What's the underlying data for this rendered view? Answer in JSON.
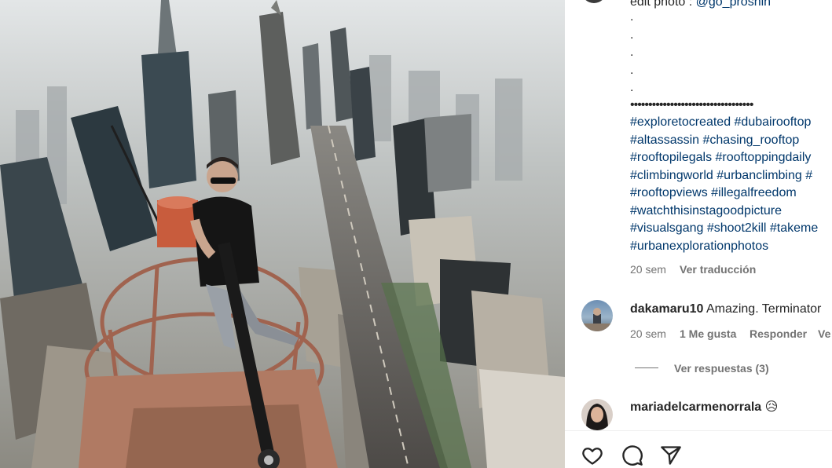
{
  "caption": {
    "edit_prefix": "edit photo : ",
    "edit_handle": "@go_proshin",
    "dot_lines": [
      ".",
      ".",
      ".",
      ".",
      "."
    ],
    "separator": "••••••••••••••••••••••••••••••••••",
    "hashtag_lines": [
      "#exploretocreated #dubairooftop",
      "#altassassin #chasing_rooftop",
      "#rooftopilegals #rooftoppingdaily",
      "#climbingworld #urbanclimbing #",
      "#rooftopviews #illegalfreedom",
      "#watchthisinstagoodpicture",
      "#visualsgang #shoot2kill #takeme",
      "#urbanexplorationphotos"
    ],
    "time": "20 sem",
    "translate": "Ver traducción"
  },
  "comments": [
    {
      "username": "dakamaru10",
      "text": "Amazing. Terminator",
      "time": "20 sem",
      "likes": "1 Me gusta",
      "reply": "Responder",
      "more": "Ve",
      "view_replies": "Ver respuestas (3)"
    },
    {
      "username": "mariadelcarmenorrala",
      "text": "😥"
    }
  ],
  "actions": {
    "like_icon": "heart-icon",
    "comment_icon": "comment-bubble-icon",
    "share_icon": "paper-plane-icon"
  },
  "colors": {
    "link": "#00376b",
    "muted": "#737373",
    "text": "#262626"
  }
}
